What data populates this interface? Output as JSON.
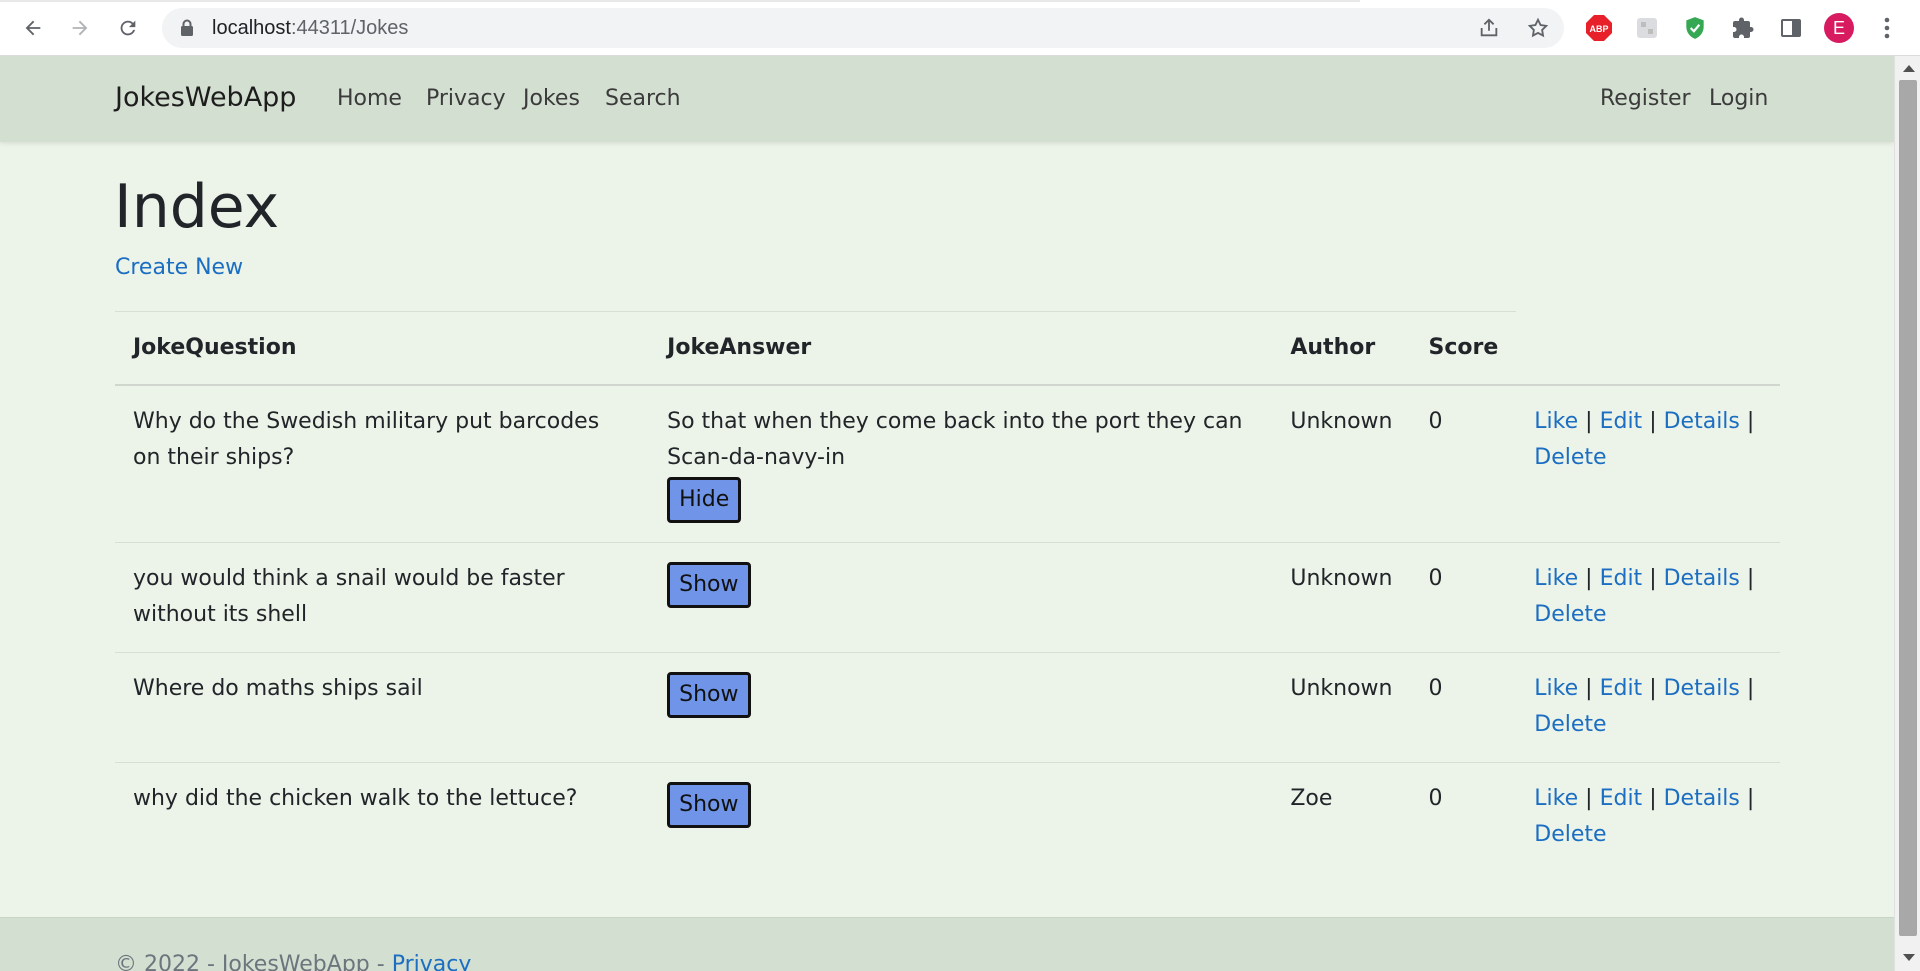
{
  "browser": {
    "url_host": "localhost",
    "url_path": ":44311/Jokes",
    "avatar_letter": "E",
    "abp_label": "ABP"
  },
  "navbar": {
    "brand": "JokesWebApp",
    "links": [
      "Home",
      "Privacy",
      "Jokes",
      "Search"
    ],
    "register": "Register",
    "login": "Login"
  },
  "page": {
    "title": "Index",
    "create_new": "Create New"
  },
  "table": {
    "headers": [
      "JokeQuestion",
      "JokeAnswer",
      "Author",
      "Score"
    ],
    "rows": [
      {
        "question": "Why do the Swedish military put barcodes on their ships?",
        "answer": "So that when they come back into the port they can Scan-da-navy-in",
        "button": "Hide",
        "author": "Unknown",
        "score": "0"
      },
      {
        "question": "you would think a snail would be faster without its shell",
        "answer": "",
        "button": "Show",
        "author": "Unknown",
        "score": "0"
      },
      {
        "question": "Where do maths ships sail",
        "answer": "",
        "button": "Show",
        "author": "Unknown",
        "score": "0"
      },
      {
        "question": "why did the chicken walk to the lettuce?",
        "answer": "",
        "button": "Show",
        "author": "Zoe",
        "score": "0"
      }
    ],
    "actions": {
      "like": "Like",
      "edit": "Edit",
      "details": "Details",
      "delete": "Delete",
      "separator": "|"
    }
  },
  "footer": {
    "copyright": "© 2022 - JokesWebApp - ",
    "privacy": "Privacy"
  }
}
